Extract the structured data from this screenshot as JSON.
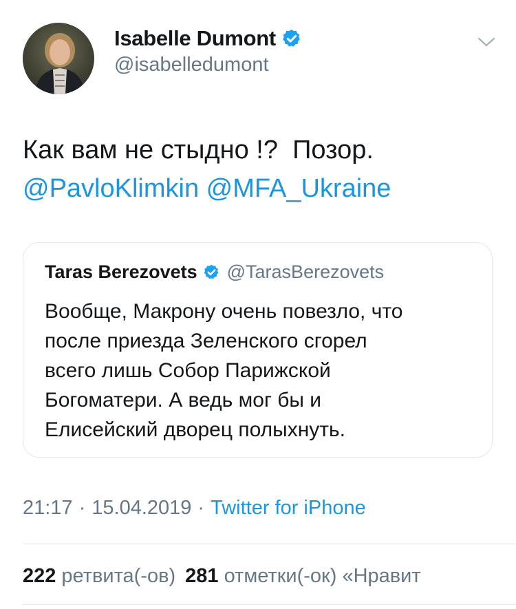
{
  "colors": {
    "link": "#1b95e0",
    "secondary_text": "#657786",
    "primary_text": "#14171a",
    "verified_badge": "#1da1f2",
    "border": "#e1e8ed"
  },
  "tweet": {
    "author": {
      "name": "Isabelle Dumont",
      "handle": "@isabelledumont",
      "verified": true,
      "avatar_icon": "avatar-photo"
    },
    "menu_icon": "chevron-down-icon",
    "text_line1": "Как вам не стыдно !?  Позор.",
    "mention1": "@PavloKlimkin",
    "mention2": "@MFA_Ukraine",
    "quoted": {
      "name": "Taras Berezovets",
      "handle": "@TarasBerezovets",
      "verified": true,
      "lines": [
        "Вообще, Макрону очень повезло, что",
        "после приезда Зеленского сгорел",
        "всего лишь Собор Парижской",
        "Богоматери. А ведь мог бы и",
        "Елисейский дворец полыхнуть."
      ]
    },
    "time": "21:17",
    "separator": "·",
    "date": "15.04.2019",
    "source": "Twitter for iPhone",
    "stats": {
      "retweets_count": "222",
      "retweets_label": "ретвита(-ов)",
      "likes_count": "281",
      "likes_label": "отметки(-ок) «Нравит"
    }
  }
}
